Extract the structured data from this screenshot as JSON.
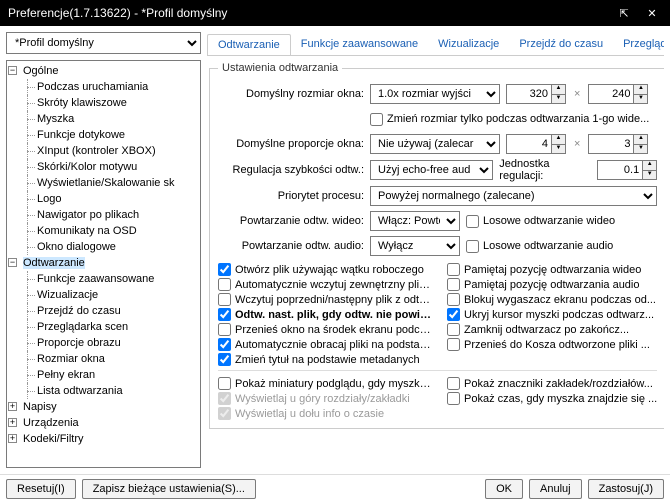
{
  "title": "Preferencje(1.7.13622) - *Profil domyślny",
  "profile": "*Profil domyślny",
  "tabs": [
    "Odtwarzanie",
    "Funkcje zaawansowane",
    "Wizualizacje",
    "Przejdź do czasu",
    "Przegląd"
  ],
  "tree": {
    "general": {
      "label": "Ogólne",
      "items": [
        "Podczas uruchamiania",
        "Skróty klawiszowe",
        "Myszka",
        "Funkcje dotykowe",
        "XInput (kontroler XBOX)",
        "Skórki/Kolor motywu",
        "Wyświetlanie/Skalowanie sk",
        "Logo",
        "Nawigator po plikach",
        "Komunikaty na OSD",
        "Okno dialogowe"
      ]
    },
    "playback": {
      "label": "Odtwarzanie",
      "items": [
        "Funkcje zaawansowane",
        "Wizualizacje",
        "Przejdź do czasu",
        "Przeglądarka scen",
        "Proporcje obrazu",
        "Rozmiar okna",
        "Pełny ekran",
        "Lista odtwarzania"
      ]
    },
    "subtitles": {
      "label": "Napisy"
    },
    "devices": {
      "label": "Urządzenia"
    },
    "codecs": {
      "label": "Kodeki/Filtry"
    }
  },
  "group": {
    "legend": "Ustawienia odtwarzania",
    "default_size_label": "Domyślny rozmiar okna:",
    "default_size_value": "1.0x rozmiar wyjści",
    "width": "320",
    "height": "240",
    "resize_first": "Zmień rozmiar tylko podczas odtwarzania 1-go wide...",
    "aspect_label": "Domyślne proporcje okna:",
    "aspect_value": "Nie używaj (zalecar",
    "aspect_w": "4",
    "aspect_h": "3",
    "speed_label": "Regulacja szybkości odtw.:",
    "speed_value": "Użyj echo-free aud",
    "speed_unit_label": "Jednostka regulacji:",
    "speed_unit": "0.1",
    "priority_label": "Priorytet procesu:",
    "priority_value": "Powyżej normalnego (zalecane)",
    "repeat_video_label": "Powtarzanie odtw. wideo:",
    "repeat_video_value": "Włącz: Powtór",
    "random_video": "Losowe odtwarzanie wideo",
    "repeat_audio_label": "Powtarzanie odtw. audio:",
    "repeat_audio_value": "Wyłącz",
    "random_audio": "Losowe odtwarzanie audio"
  },
  "checks": {
    "left": [
      "Otwórz plik używając wątku roboczego",
      "Automatycznie wczytuj zewnętrzny plik ...",
      "Wczytuj poprzedni/następny plik z odtw...",
      "Odtw. nast. plik, gdy odtw. nie powiod...",
      "Przenieś okno na środek ekranu podczas...",
      "Automatycznie obracaj pliki na podstawi...",
      "Zmień tytuł na podstawie metadanych"
    ],
    "right": [
      "Pamiętaj pozycję odtwarzania wideo",
      "Pamiętaj pozycję odtwarzania audio",
      "Blokuj wygaszacz ekranu podczas od...",
      "Ukryj kursor myszki podczas odtwarz...",
      "Zamknij odtwarzacz po zakończ...",
      "Przenieś do Kosza odtworzone pliki ..."
    ],
    "bottom_left": [
      "Pokaż miniatury podglądu, gdy myszka ...",
      "Wyświetlaj u góry rozdziały/zakładki",
      "Wyświetlaj u dołu info o czasie"
    ],
    "bottom_right": [
      "Pokaż znaczniki zakładek/rozdziałów...",
      "Pokaż czas, gdy myszka znajdzie się ..."
    ]
  },
  "footer": {
    "reset": "Resetuj(I)",
    "save": "Zapisz bieżące ustawienia(S)...",
    "ok": "OK",
    "cancel": "Anuluj",
    "apply": "Zastosuj(J)"
  }
}
